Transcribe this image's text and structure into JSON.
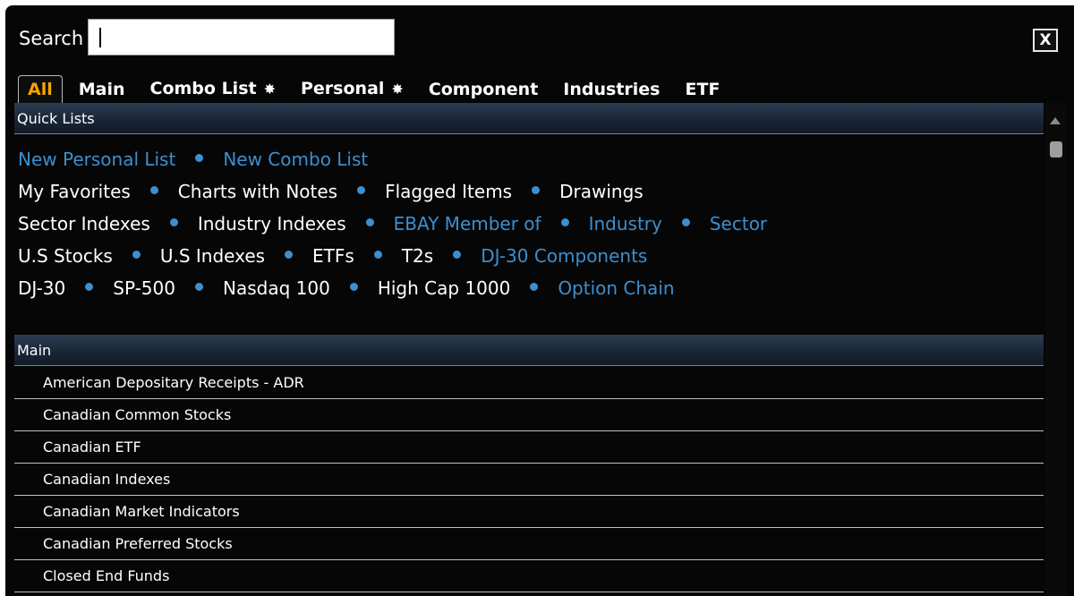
{
  "search": {
    "label": "Search",
    "value": "",
    "placeholder": ""
  },
  "close": {
    "label": "X"
  },
  "tabs": [
    {
      "label": "All",
      "active": true,
      "star": ""
    },
    {
      "label": "Main",
      "active": false,
      "star": ""
    },
    {
      "label": "Combo List",
      "active": false,
      "star": "✸"
    },
    {
      "label": "Personal",
      "active": false,
      "star": "✸"
    },
    {
      "label": "Component",
      "active": false,
      "star": ""
    },
    {
      "label": "Industries",
      "active": false,
      "star": ""
    },
    {
      "label": "ETF",
      "active": false,
      "star": ""
    }
  ],
  "quick_lists": {
    "header": "Quick Lists",
    "lines": [
      [
        {
          "label": "New Personal List",
          "color": "blue"
        },
        {
          "label": "New Combo List",
          "color": "blue"
        }
      ],
      [
        {
          "label": "My Favorites",
          "color": "white"
        },
        {
          "label": "Charts with Notes",
          "color": "white"
        },
        {
          "label": "Flagged Items",
          "color": "white"
        },
        {
          "label": "Drawings",
          "color": "white"
        }
      ],
      [
        {
          "label": "Sector Indexes",
          "color": "white"
        },
        {
          "label": "Industry Indexes",
          "color": "white"
        },
        {
          "label": "EBAY Member of",
          "color": "blue"
        },
        {
          "label": "Industry",
          "color": "blue"
        },
        {
          "label": "Sector",
          "color": "blue"
        }
      ],
      [
        {
          "label": "U.S Stocks",
          "color": "white"
        },
        {
          "label": "U.S Indexes",
          "color": "white"
        },
        {
          "label": "ETFs",
          "color": "white"
        },
        {
          "label": "T2s",
          "color": "white"
        },
        {
          "label": "DJ-30 Components",
          "color": "blue"
        }
      ],
      [
        {
          "label": "DJ-30",
          "color": "white"
        },
        {
          "label": "SP-500",
          "color": "white"
        },
        {
          "label": "Nasdaq 100",
          "color": "white"
        },
        {
          "label": "High Cap 1000",
          "color": "white"
        },
        {
          "label": "Option Chain",
          "color": "blue"
        }
      ]
    ]
  },
  "main": {
    "header": "Main",
    "items": [
      "American Depositary Receipts - ADR",
      "Canadian Common Stocks",
      "Canadian ETF",
      "Canadian Indexes",
      "Canadian Market Indicators",
      "Canadian Preferred Stocks",
      "Closed End Funds"
    ]
  },
  "colors": {
    "background": "#060606",
    "active_tab": "#f5a500",
    "link_blue": "#3c8fd0",
    "header_gradient_top": "#2c3d52"
  }
}
